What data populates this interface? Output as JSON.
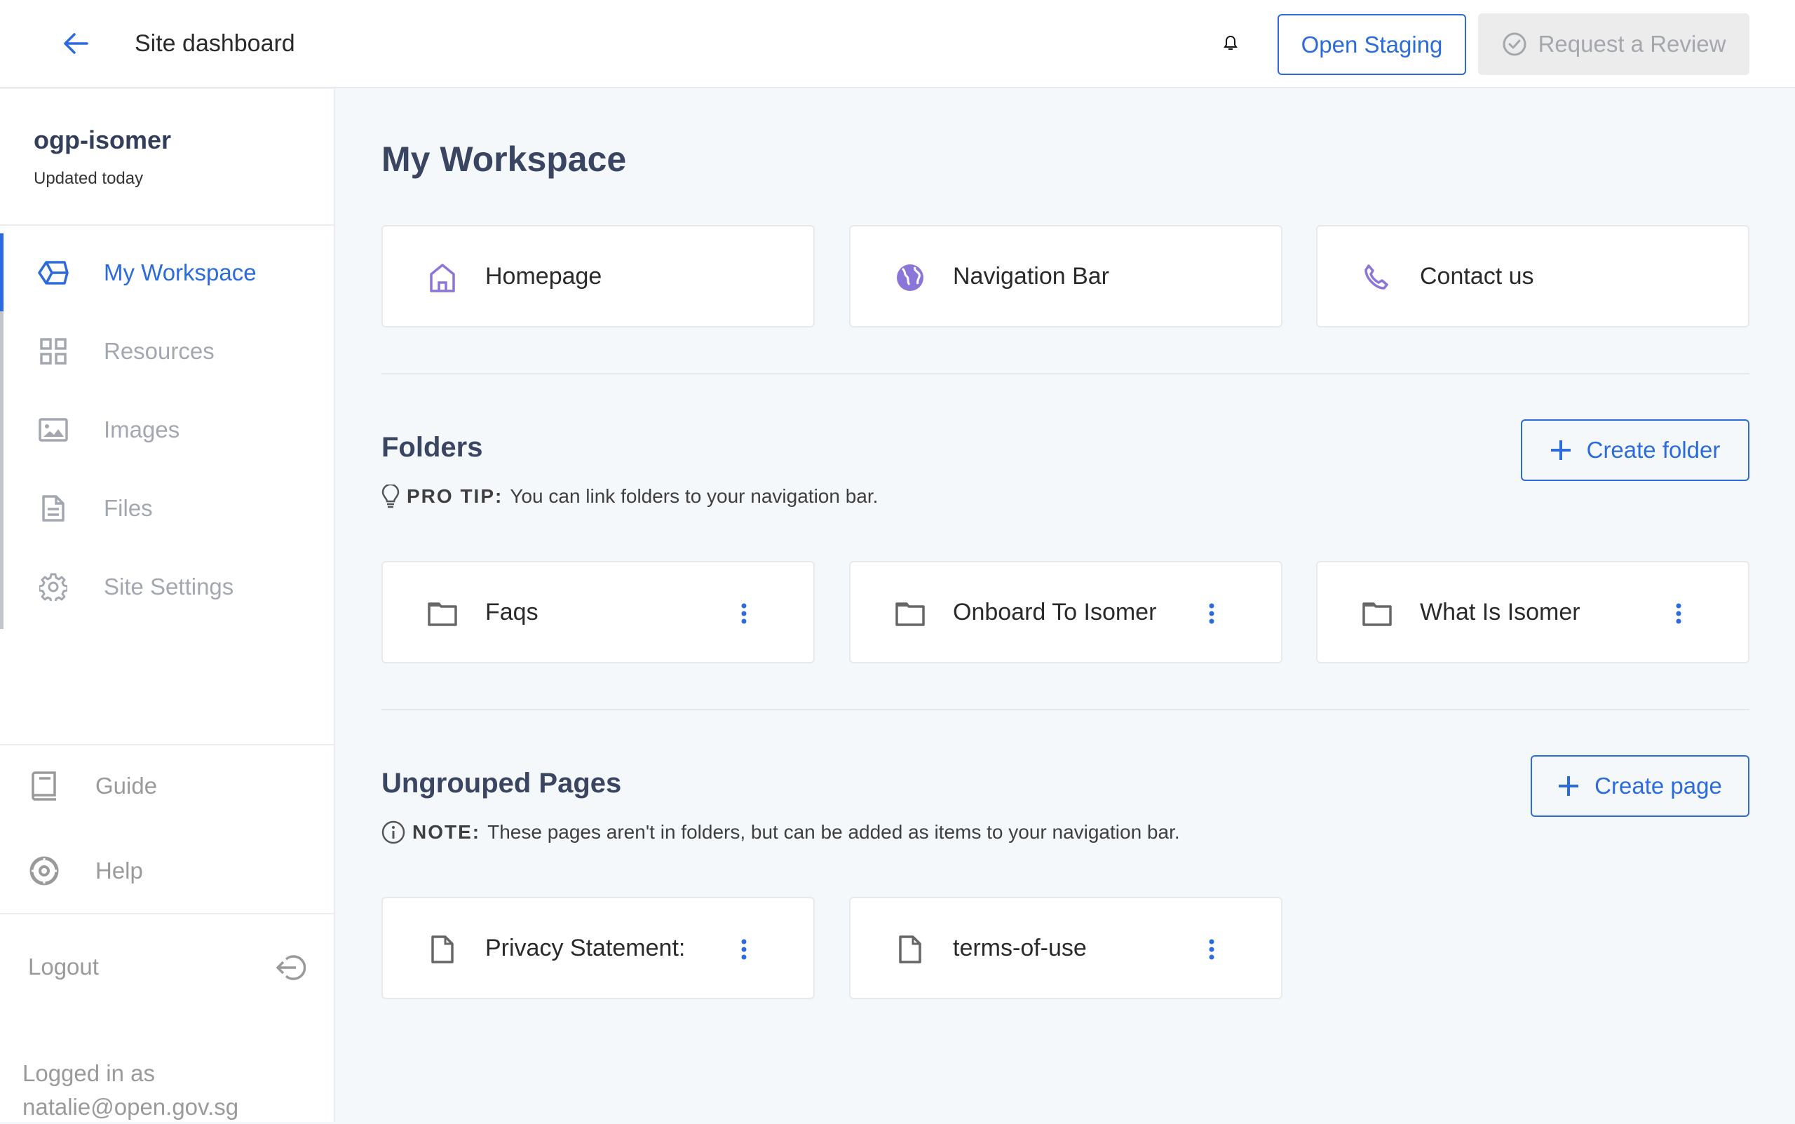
{
  "header": {
    "back_icon": "arrow-left-icon",
    "title": "Site dashboard",
    "notifications_icon": "bell-icon",
    "open_staging_label": "Open Staging",
    "request_review_label": "Request a Review",
    "request_review_icon": "check-circle-icon"
  },
  "sidebar": {
    "site_name": "ogp-isomer",
    "updated": "Updated today",
    "items": [
      {
        "label": "My Workspace",
        "icon": "workspace-box-icon",
        "active": true
      },
      {
        "label": "Resources",
        "icon": "grid-icon",
        "active": false
      },
      {
        "label": "Images",
        "icon": "image-icon",
        "active": false
      },
      {
        "label": "Files",
        "icon": "file-text-icon",
        "active": false
      },
      {
        "label": "Site Settings",
        "icon": "gear-icon",
        "active": false
      }
    ],
    "utility": [
      {
        "label": "Guide",
        "icon": "book-icon"
      },
      {
        "label": "Help",
        "icon": "lifebuoy-icon"
      }
    ],
    "logout_label": "Logout",
    "logout_icon": "logout-icon",
    "logged_in_label": "Logged in as",
    "logged_in_email": "natalie@open.gov.sg"
  },
  "main": {
    "title": "My Workspace",
    "workspace_cards": [
      {
        "label": "Homepage",
        "icon": "home-icon"
      },
      {
        "label": "Navigation Bar",
        "icon": "globe-icon"
      },
      {
        "label": "Contact us",
        "icon": "phone-icon"
      }
    ],
    "folders": {
      "title": "Folders",
      "tip_prefix": "PRO TIP:",
      "tip_text": "You can link folders to your navigation bar.",
      "create_label": "Create folder",
      "items": [
        {
          "label": "Faqs"
        },
        {
          "label": "Onboard To Isomer"
        },
        {
          "label": "What Is Isomer"
        }
      ]
    },
    "ungrouped": {
      "title": "Ungrouped Pages",
      "note_prefix": "NOTE:",
      "note_text": "These pages aren't in folders, but can be added as items to your navigation bar.",
      "create_label": "Create page",
      "items": [
        {
          "label": "Privacy Statement:"
        },
        {
          "label": "terms-of-use"
        }
      ]
    }
  },
  "colors": {
    "accent": "#2b6bdc",
    "heading": "#3a4562",
    "icon_purple": "#8c75d9",
    "muted": "#a3a8b0",
    "background": "#f5f8fb"
  }
}
